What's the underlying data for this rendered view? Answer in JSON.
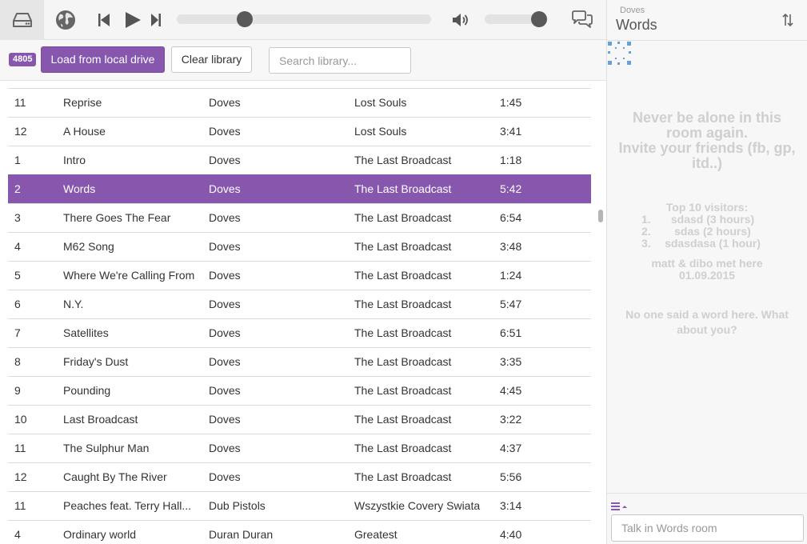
{
  "library": {
    "count": "4805",
    "load_label": "Load from local drive",
    "clear_label": "Clear library",
    "search_placeholder": "Search library..."
  },
  "tracks": [
    {
      "num": "11",
      "title": "Reprise",
      "artist": "Doves",
      "album": "Lost Souls",
      "duration": "1:45"
    },
    {
      "num": "12",
      "title": "A House",
      "artist": "Doves",
      "album": "Lost Souls",
      "duration": "3:41"
    },
    {
      "num": "1",
      "title": "Intro",
      "artist": "Doves",
      "album": "The Last Broadcast",
      "duration": "1:18"
    },
    {
      "num": "2",
      "title": "Words",
      "artist": "Doves",
      "album": "The Last Broadcast",
      "duration": "5:42",
      "active": true
    },
    {
      "num": "3",
      "title": "There Goes The Fear",
      "artist": "Doves",
      "album": "The Last Broadcast",
      "duration": "6:54"
    },
    {
      "num": "4",
      "title": "M62 Song",
      "artist": "Doves",
      "album": "The Last Broadcast",
      "duration": "3:48"
    },
    {
      "num": "5",
      "title": "Where We're Calling From",
      "artist": "Doves",
      "album": "The Last Broadcast",
      "duration": "1:24"
    },
    {
      "num": "6",
      "title": "N.Y.",
      "artist": "Doves",
      "album": "The Last Broadcast",
      "duration": "5:47"
    },
    {
      "num": "7",
      "title": "Satellites",
      "artist": "Doves",
      "album": "The Last Broadcast",
      "duration": "6:51"
    },
    {
      "num": "8",
      "title": "Friday's Dust",
      "artist": "Doves",
      "album": "The Last Broadcast",
      "duration": "3:35"
    },
    {
      "num": "9",
      "title": "Pounding",
      "artist": "Doves",
      "album": "The Last Broadcast",
      "duration": "4:45"
    },
    {
      "num": "10",
      "title": "Last Broadcast",
      "artist": "Doves",
      "album": "The Last Broadcast",
      "duration": "3:22"
    },
    {
      "num": "11",
      "title": "The Sulphur Man",
      "artist": "Doves",
      "album": "The Last Broadcast",
      "duration": "4:37"
    },
    {
      "num": "12",
      "title": "Caught By The River",
      "artist": "Doves",
      "album": "The Last Broadcast",
      "duration": "5:56"
    },
    {
      "num": "11",
      "title": "Peaches feat. Terry Hall...",
      "artist": "Dub Pistols",
      "album": "Wszystkie Covery Swiata",
      "duration": "3:14"
    },
    {
      "num": "4",
      "title": "Ordinary world",
      "artist": "Duran Duran",
      "album": "Greatest",
      "duration": "4:40"
    }
  ],
  "now_playing": {
    "artist": "Doves",
    "title": "Words"
  },
  "room": {
    "invite_line1": "Never be alone in this room again.",
    "invite_line2": "Invite your friends (fb, gp, itd..)",
    "top_title": "Top 10 visitors:",
    "top_visitors": [
      {
        "num": "1.",
        "name": "sdasd (3 hours)"
      },
      {
        "num": "2.",
        "name": "sdas (2 hours)"
      },
      {
        "num": "3.",
        "name": "sdasdasa (1 hour)"
      }
    ],
    "met_line1": "matt & dibo met here",
    "met_line2": "01.09.2015",
    "empty_message": "No one said a word here. What about you?"
  },
  "chat": {
    "placeholder": "Talk in Words room"
  },
  "colors": {
    "accent": "#8657ad",
    "room_text": "#cfcfcf"
  },
  "icons": [
    "drive-icon",
    "globe-icon",
    "previous-icon",
    "play-icon",
    "next-icon",
    "volume-icon",
    "chat-icon",
    "sort-icon",
    "loader-icon",
    "menu-icon"
  ],
  "player": {
    "progress": 0.25,
    "volume": 1.0
  }
}
